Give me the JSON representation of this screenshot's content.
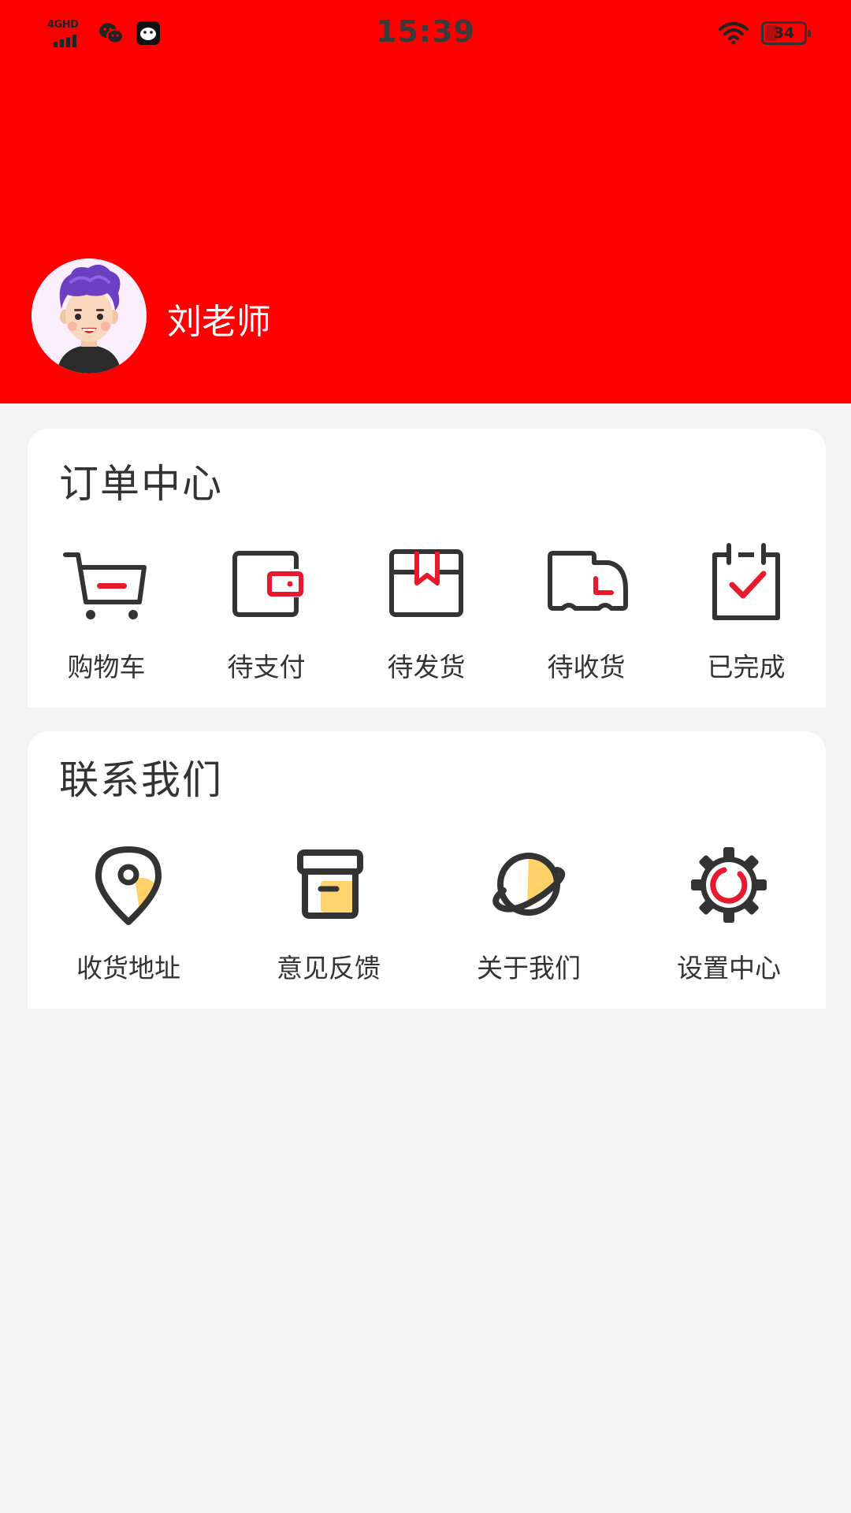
{
  "status_bar": {
    "network": "4GHD",
    "time": "15:39",
    "battery": "34",
    "battery_level_percent": 34
  },
  "profile": {
    "name": "刘老师"
  },
  "orders": {
    "title": "订单中心",
    "items": [
      {
        "label": "购物车",
        "icon": "shopping-cart-icon"
      },
      {
        "label": "待支付",
        "icon": "wallet-icon"
      },
      {
        "label": "待发货",
        "icon": "package-icon"
      },
      {
        "label": "待收货",
        "icon": "delivery-truck-icon"
      },
      {
        "label": "已完成",
        "icon": "calendar-check-icon"
      }
    ]
  },
  "contact": {
    "title": "联系我们",
    "items": [
      {
        "label": "收货地址",
        "icon": "location-pin-icon"
      },
      {
        "label": "意见反馈",
        "icon": "archive-box-icon"
      },
      {
        "label": "关于我们",
        "icon": "planet-icon"
      },
      {
        "label": "设置中心",
        "icon": "gear-icon"
      }
    ]
  },
  "colors": {
    "header": "#ff0000",
    "accent": "#e8192c",
    "icon_stroke": "#333333",
    "icon_highlight": "#ffc94d",
    "background": "#f3f3f3",
    "card": "#ffffff"
  }
}
